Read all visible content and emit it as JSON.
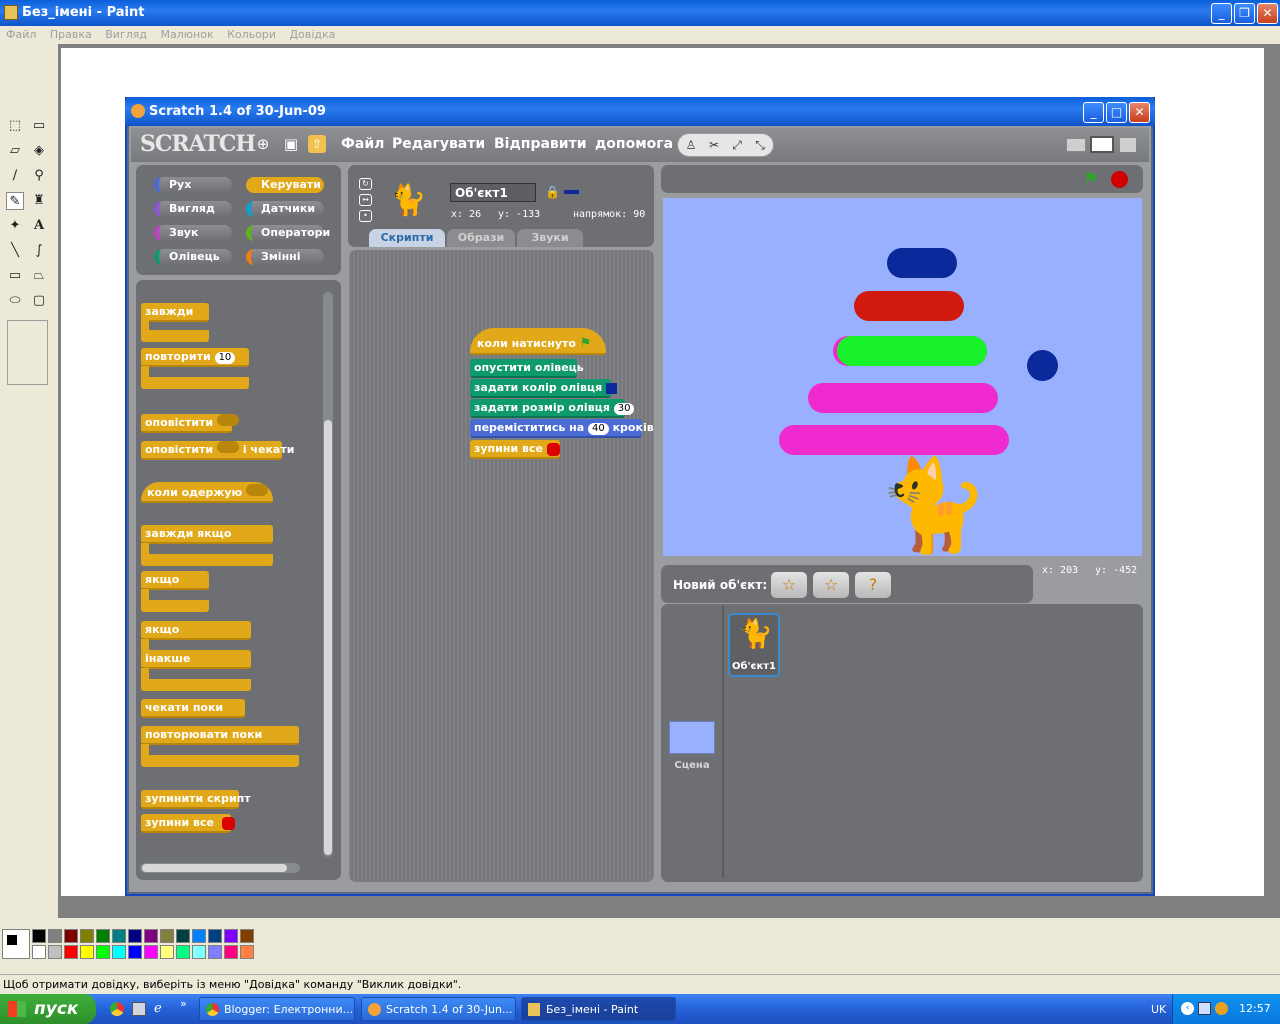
{
  "paint": {
    "title": "Без_імені - Paint",
    "menu": [
      "Файл",
      "Правка",
      "Вигляд",
      "Малюнок",
      "Кольори",
      "Довідка"
    ],
    "status": "Щоб отримати довідку, виберіть із меню \"Довідка\" команду \"Виклик довідки\".",
    "tools": [
      "free-select-icon",
      "rect-select-icon",
      "eraser-icon",
      "fill-icon",
      "eyedropper-icon",
      "magnifier-icon",
      "pencil-icon",
      "brush-icon",
      "airbrush-icon",
      "text-icon",
      "line-icon",
      "curve-icon",
      "rectangle-icon",
      "polygon-icon",
      "ellipse-icon",
      "rounded-rect-icon"
    ],
    "palette_top": [
      "#000000",
      "#808080",
      "#800000",
      "#808000",
      "#008000",
      "#008080",
      "#000080",
      "#800080",
      "#808040",
      "#004040",
      "#0080ff",
      "#004080",
      "#8000ff",
      "#804000"
    ],
    "palette_bottom": [
      "#ffffff",
      "#c0c0c0",
      "#ff0000",
      "#ffff00",
      "#00ff00",
      "#00ffff",
      "#0000ff",
      "#ff00ff",
      "#ffff80",
      "#00ff80",
      "#80ffff",
      "#8080ff",
      "#ff0080",
      "#ff8040"
    ]
  },
  "scratch": {
    "title": "Scratch 1.4 of 30-Jun-09",
    "logo": "SCRATCH",
    "menu": [
      "Файл",
      "Редагувати",
      "Відправити",
      "допомога"
    ],
    "categories": [
      {
        "label": "Рух",
        "color": "#4a6cd4"
      },
      {
        "label": "Керувати",
        "color": "#e1a91a"
      },
      {
        "label": "Вигляд",
        "color": "#8a55d7"
      },
      {
        "label": "Датчики",
        "color": "#0d9fd0"
      },
      {
        "label": "Звук",
        "color": "#bb42c3"
      },
      {
        "label": "Оператори",
        "color": "#5cb712"
      },
      {
        "label": "Олівець",
        "color": "#0e9a6c"
      },
      {
        "label": "Змінні",
        "color": "#ee7d16"
      }
    ],
    "palette_blocks": {
      "forever": "завжди",
      "repeat": "повторити",
      "repeat_n": "10",
      "broadcast": "оповістити",
      "broadcast_wait": "оповістити",
      "and_wait": "і чекати",
      "when_receive": "коли одержую",
      "forever_if": "завжди якщо",
      "if": "якщо",
      "if_else": "якщо",
      "else": "інакше",
      "wait_until": "чекати поки",
      "repeat_until": "повторювати поки",
      "stop_script": "зупинити скрипт",
      "stop_all": "зупини все"
    },
    "sprite": {
      "name": "Об'єкт1",
      "x_label": "x: 26",
      "y_label": "y: -133",
      "direction_label": "напрямок: 90"
    },
    "tabs": [
      "Скрипти",
      "Образи",
      "Звуки"
    ],
    "script": {
      "hat": "коли натиснуто",
      "pen_down": "опустити олівець",
      "set_color": "задати колір олівця",
      "set_size": "задати розмір олівця",
      "size_value": "30",
      "move": "переміститись на",
      "move_value": "40",
      "move_unit": "кроків",
      "stop": "зупини все"
    },
    "mouse": {
      "x": "x: 203",
      "y": "y: -452"
    },
    "new_sprite_label": "Новий об'єкт:",
    "sprite_thumb_label": "Об'єкт1",
    "stage_label": "Сцена",
    "stage_bg": "#99b0ff"
  },
  "taskbar": {
    "start": "пуск",
    "buttons": [
      "Blogger: Електронни...",
      "Scratch 1.4 of 30-Jun...",
      "Без_імені - Paint"
    ],
    "lang": "UK",
    "time": "12:57"
  }
}
